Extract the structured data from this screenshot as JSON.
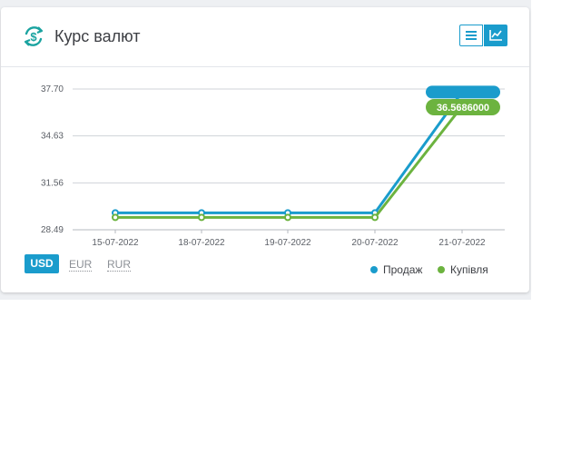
{
  "widget": {
    "title": "Курс валют",
    "logo_icon": "currency-exchange-icon",
    "view_buttons": [
      {
        "name": "list-view",
        "icon": "list-icon",
        "active": false
      },
      {
        "name": "chart-view",
        "icon": "line-chart-icon",
        "active": true
      }
    ]
  },
  "currencies": [
    {
      "label": "USD",
      "active": true
    },
    {
      "label": "EUR",
      "active": false
    },
    {
      "label": "RUR",
      "active": false
    }
  ],
  "legend": [
    {
      "label": "Продаж",
      "color": "#1a9ccc"
    },
    {
      "label": "Купівля",
      "color": "#6cb33f"
    }
  ],
  "chart_data": {
    "type": "line",
    "categories": [
      "15-07-2022",
      "18-07-2022",
      "19-07-2022",
      "20-07-2022",
      "21-07-2022"
    ],
    "series": [
      {
        "name": "Продаж",
        "color": "#1a9ccc",
        "values": [
          29.6,
          29.6,
          29.6,
          29.6,
          37.5
        ]
      },
      {
        "name": "Купівля",
        "color": "#6cb33f",
        "values": [
          29.3,
          29.3,
          29.3,
          29.3,
          36.5686
        ]
      }
    ],
    "yticks": [
      "37.70",
      "34.63",
      "31.56",
      "28.49"
    ],
    "ylim": [
      28.49,
      37.7
    ],
    "grid": true,
    "tooltip": {
      "label": "36.5686000",
      "series_index": 1,
      "point_index": 4
    }
  }
}
